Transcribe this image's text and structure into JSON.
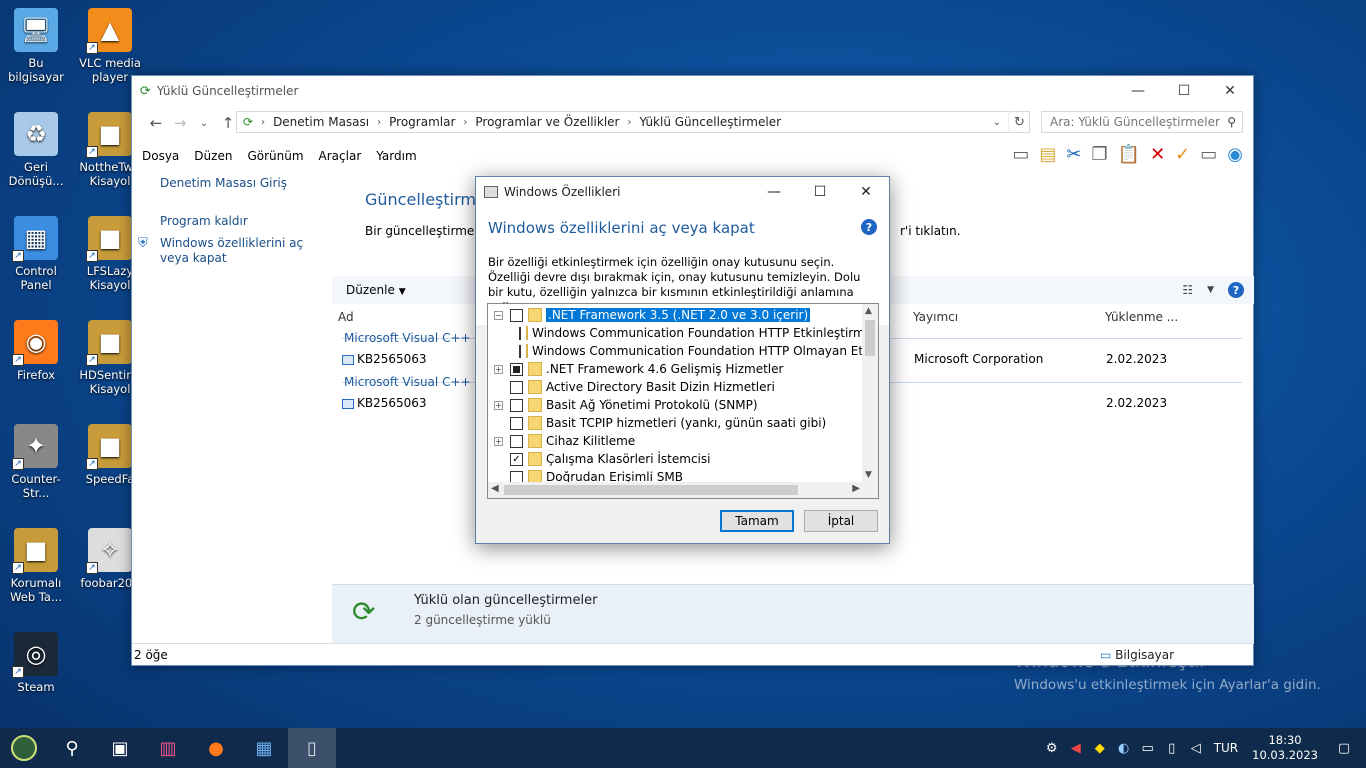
{
  "desktop": {
    "icons": [
      {
        "label": "Bu bilgisayar",
        "icon": "computer-icon"
      },
      {
        "label": "VLC media player",
        "icon": "vlc-icon"
      },
      {
        "label": "Geri Dönüşü...",
        "icon": "recycle-bin-icon"
      },
      {
        "label": "NottheTw - Kisayol",
        "icon": "app-icon"
      },
      {
        "label": "Control Panel",
        "icon": "control-panel-icon"
      },
      {
        "label": "LFSLazy Kisayol",
        "icon": "app-icon"
      },
      {
        "label": "Firefox",
        "icon": "firefox-icon"
      },
      {
        "label": "HDSentine Kisayol",
        "icon": "app-icon"
      },
      {
        "label": "Counter-Str...",
        "icon": "game-icon"
      },
      {
        "label": "SpeedFa",
        "icon": "app-icon"
      },
      {
        "label": "Korumalı Web Ta...",
        "icon": "app-icon"
      },
      {
        "label": "foobar200",
        "icon": "foobar-icon"
      },
      {
        "label": "Steam",
        "icon": "steam-icon"
      }
    ],
    "watermark_title": "Windows'u Etkinleştir",
    "watermark_sub": "Windows'u etkinleştirmek için Ayarlar'a gidin."
  },
  "explorer": {
    "title": "Yüklü Güncelleştirmeler",
    "breadcrumb": [
      "Denetim Masası",
      "Programlar",
      "Programlar ve Özellikler",
      "Yüklü Güncelleştirmeler"
    ],
    "search_placeholder": "Ara: Yüklü Güncelleştirmeler",
    "menu": [
      "Dosya",
      "Düzen",
      "Görünüm",
      "Araçlar",
      "Yardım"
    ],
    "left_links": [
      "Denetim Masası Giriş",
      "Program kaldır",
      "Windows özelliklerini aç veya kapat"
    ],
    "heading": "Güncelleştirme k",
    "desc": "Bir güncelleştirmeyi k",
    "desc_tail": "r'i tıklatın.",
    "organize": "Düzenle",
    "columns": {
      "name": "Ad",
      "publisher": "Yayımcı",
      "installed": "Yüklenme ..."
    },
    "groups": [
      {
        "title": "Microsoft Visual C++ 201",
        "item": "KB2565063",
        "publisher": "Microsoft Corporation",
        "date": "2.02.2023"
      },
      {
        "title": "Microsoft Visual C++ 201",
        "item": "KB2565063",
        "publisher": "",
        "date": "2.02.2023"
      }
    ],
    "details_title": "Yüklü olan güncelleştirmeler",
    "details_sub": "2 güncelleştirme yüklü",
    "status_count": "2 öğe",
    "status_location": "Bilgisayar"
  },
  "dialog": {
    "title": "Windows Özellikleri",
    "heading": "Windows özelliklerini aç veya kapat",
    "description": "Bir özelliği etkinleştirmek için özelliğin onay kutusunu seçin. Özelliği devre dışı bırakmak için, onay kutusunu temizleyin. Dolu bir kutu, özelliğin yalnızca bir kısmının etkinleştirildiği anlamına gelir.",
    "features": [
      {
        "label": ".NET Framework 3.5 (.NET 2.0 ve 3.0 içerir)",
        "expander": "−",
        "state": "unchecked",
        "indent": 0,
        "selected": true
      },
      {
        "label": "Windows Communication Foundation HTTP Etkinleştirm",
        "expander": "",
        "state": "unchecked",
        "indent": 1
      },
      {
        "label": "Windows Communication Foundation HTTP Olmayan Et",
        "expander": "",
        "state": "unchecked",
        "indent": 1
      },
      {
        "label": ".NET Framework 4.6 Gelişmiş Hizmetler",
        "expander": "+",
        "state": "partial",
        "indent": 0
      },
      {
        "label": "Active Directory Basit Dizin Hizmetleri",
        "expander": "",
        "state": "unchecked",
        "indent": 0
      },
      {
        "label": "Basit Ağ Yönetimi Protokolü (SNMP)",
        "expander": "+",
        "state": "unchecked",
        "indent": 0
      },
      {
        "label": "Basit TCPIP hizmetleri (yankı, günün saati gibi)",
        "expander": "",
        "state": "unchecked",
        "indent": 0
      },
      {
        "label": "Cihaz Kilitleme",
        "expander": "+",
        "state": "unchecked",
        "indent": 0
      },
      {
        "label": "Çalışma Klasörleri İstemcisi",
        "expander": "",
        "state": "checked",
        "indent": 0
      },
      {
        "label": "Doğrudan Erişimli SMB",
        "expander": "",
        "state": "unchecked",
        "indent": 0
      }
    ],
    "ok_label": "Tamam",
    "cancel_label": "İptal"
  },
  "taskbar": {
    "language": "TUR",
    "time": "18:30",
    "date": "10.03.2023"
  }
}
